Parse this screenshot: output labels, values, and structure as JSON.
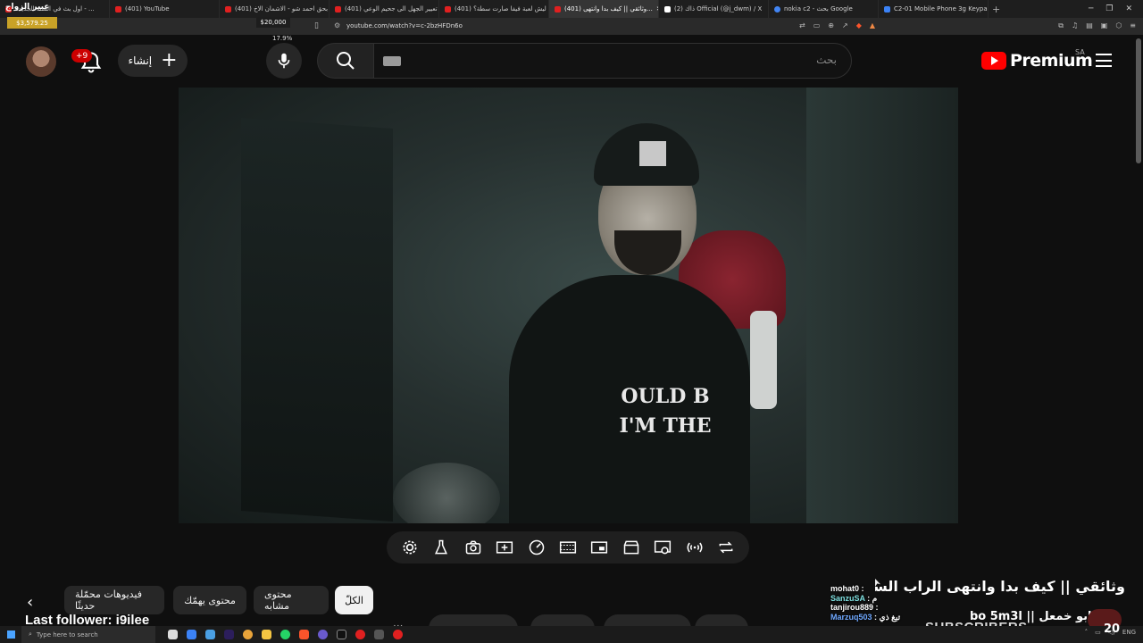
{
  "browser": {
    "tabs": [
      {
        "title": "اول بث في السنة الجديدة - ...",
        "favicon": "youtube-icon"
      },
      {
        "title": "(401) YouTube",
        "favicon": "youtube-icon"
      },
      {
        "title": "(401) كلمة بحق احمد شو - الاشمان الاخ...",
        "favicon": "youtube-icon"
      },
      {
        "title": "(401) من تعيير الجهل الى جحيم الوعي |",
        "favicon": "youtube-icon"
      },
      {
        "title": "(401) ليش لعبة فيفا صارت سطة؟ - ...",
        "favicon": "youtube-icon"
      },
      {
        "title": "(401) وثائقي || كيف بدا وانتهى...",
        "favicon": "youtube-icon",
        "active": true
      },
      {
        "title": "(2) ذاك Official (@j_dwm) / X",
        "favicon": "x-icon"
      },
      {
        "title": "nokia c2 - بحث Google",
        "favicon": "google-icon"
      },
      {
        "title": "C2-01 Mobile Phone 3g Keypad Har...",
        "favicon": "bookmark-icon"
      }
    ],
    "new_tab": "+",
    "url": "youtube.com/watch?v=c-2bzHFDn6o"
  },
  "overlay": {
    "title": "عبير الزواج",
    "money_left": "$3,579.25",
    "money_goal": "$20,000",
    "percent": "17.9%"
  },
  "header": {
    "notifications_badge": "+9",
    "create_label": "إنشاء",
    "search_placeholder": "بحث",
    "brand": "Premium",
    "region": "SA"
  },
  "video": {
    "shirt_text_line1": "OULD B",
    "shirt_text_line2": "I'M THE"
  },
  "controls": [
    {
      "name": "settings-gear-icon"
    },
    {
      "name": "flask-icon"
    },
    {
      "name": "camera-icon"
    },
    {
      "name": "clip-plus-icon"
    },
    {
      "name": "speed-gauge-icon"
    },
    {
      "name": "film-strip-icon"
    },
    {
      "name": "picture-in-picture-icon"
    },
    {
      "name": "clapper-icon"
    },
    {
      "name": "cast-eye-icon"
    },
    {
      "name": "audio-waves-icon"
    },
    {
      "name": "loop-icon"
    }
  ],
  "chips": {
    "all": "الكلّ",
    "similar": "محتوى مشابه",
    "interest": "محتوى يهمّك",
    "recent": "فيديوهات محمّلة حديثًا"
  },
  "stream": {
    "last_follower": "Last follower: i9ilee",
    "subscribers_label": "SUBSCRIBERS",
    "subscribers_count": "20"
  },
  "sidebar": {
    "title": "وثائقي || كيف بدا وانتهى الراب السعودي",
    "channel": "bo 5m3l || ابو خمعل"
  },
  "chat": [
    {
      "user": "mohat0",
      "text": ""
    },
    {
      "user": "SanzuSA",
      "text": "م"
    },
    {
      "user": "tanjirou889",
      "text": ""
    },
    {
      "user": "Marzuq503",
      "text": "تبغ ذي"
    }
  ],
  "taskbar": {
    "search_placeholder": "Type here to search",
    "lang": "ENG"
  }
}
